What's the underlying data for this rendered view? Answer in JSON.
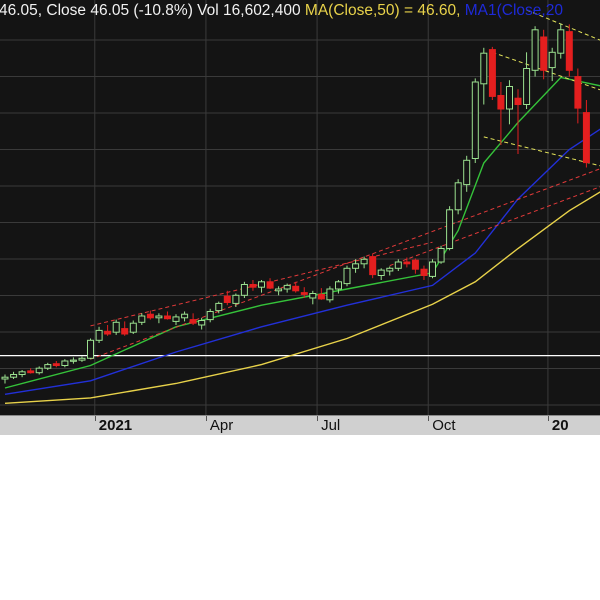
{
  "header": {
    "prefix_text": "46.05, Close 46.05 (-10.8%) Vol 16,602,400",
    "ma50_text": "MA(Close,50) = 46.60,",
    "ma20_text": "MA1(Close,20",
    "colors": {
      "base": "#f2f2f2",
      "ma50": "#e8d24a",
      "ma20": "#1e2ad8"
    }
  },
  "xaxis": {
    "labels": [
      {
        "text": "2021",
        "bold": true
      },
      {
        "text": "Apr",
        "bold": false
      },
      {
        "text": "Jul",
        "bold": false
      },
      {
        "text": "Oct",
        "bold": false
      },
      {
        "text": "20",
        "bold": true
      }
    ]
  },
  "chart_data": {
    "type": "candlestick",
    "title": "",
    "y_unit": "price",
    "week_index_domain": [
      0,
      68
    ],
    "price_range": [
      18,
      64
    ],
    "weeks": [
      {
        "o": 22.0,
        "h": 22.5,
        "l": 21.5,
        "c": 22.2
      },
      {
        "o": 22.2,
        "h": 22.8,
        "l": 22.0,
        "c": 22.5
      },
      {
        "o": 22.5,
        "h": 23.0,
        "l": 22.2,
        "c": 22.8
      },
      {
        "o": 22.9,
        "h": 23.2,
        "l": 22.6,
        "c": 22.7
      },
      {
        "o": 22.7,
        "h": 23.4,
        "l": 22.5,
        "c": 23.2
      },
      {
        "o": 23.2,
        "h": 23.8,
        "l": 23.0,
        "c": 23.6
      },
      {
        "o": 23.7,
        "h": 24.0,
        "l": 23.3,
        "c": 23.5
      },
      {
        "o": 23.5,
        "h": 24.2,
        "l": 23.3,
        "c": 24.0
      },
      {
        "o": 24.0,
        "h": 24.4,
        "l": 23.7,
        "c": 24.1
      },
      {
        "o": 24.1,
        "h": 24.5,
        "l": 23.9,
        "c": 24.3
      },
      {
        "o": 24.3,
        "h": 26.5,
        "l": 24.2,
        "c": 26.3
      },
      {
        "o": 26.3,
        "h": 27.8,
        "l": 26.0,
        "c": 27.4
      },
      {
        "o": 27.3,
        "h": 28.0,
        "l": 26.8,
        "c": 27.0
      },
      {
        "o": 27.2,
        "h": 28.6,
        "l": 26.9,
        "c": 28.3
      },
      {
        "o": 27.6,
        "h": 28.4,
        "l": 26.8,
        "c": 27.0
      },
      {
        "o": 27.2,
        "h": 28.5,
        "l": 27.0,
        "c": 28.2
      },
      {
        "o": 28.3,
        "h": 29.3,
        "l": 28.0,
        "c": 29.0
      },
      {
        "o": 29.2,
        "h": 29.6,
        "l": 28.6,
        "c": 28.8
      },
      {
        "o": 28.8,
        "h": 29.3,
        "l": 28.2,
        "c": 29.0
      },
      {
        "o": 29.0,
        "h": 29.5,
        "l": 28.6,
        "c": 28.7
      },
      {
        "o": 28.4,
        "h": 29.2,
        "l": 28.0,
        "c": 28.9
      },
      {
        "o": 28.8,
        "h": 29.5,
        "l": 28.4,
        "c": 29.2
      },
      {
        "o": 28.6,
        "h": 29.3,
        "l": 28.0,
        "c": 28.2
      },
      {
        "o": 28.0,
        "h": 28.8,
        "l": 27.5,
        "c": 28.5
      },
      {
        "o": 28.6,
        "h": 29.8,
        "l": 28.3,
        "c": 29.5
      },
      {
        "o": 29.6,
        "h": 30.6,
        "l": 29.3,
        "c": 30.4
      },
      {
        "o": 31.2,
        "h": 31.8,
        "l": 30.2,
        "c": 30.5
      },
      {
        "o": 30.4,
        "h": 31.5,
        "l": 30.0,
        "c": 31.3
      },
      {
        "o": 31.3,
        "h": 32.8,
        "l": 31.0,
        "c": 32.5
      },
      {
        "o": 32.5,
        "h": 33.0,
        "l": 31.8,
        "c": 32.2
      },
      {
        "o": 32.2,
        "h": 33.0,
        "l": 31.6,
        "c": 32.8
      },
      {
        "o": 32.8,
        "h": 33.2,
        "l": 32.0,
        "c": 32.1
      },
      {
        "o": 31.8,
        "h": 32.3,
        "l": 31.3,
        "c": 32.0
      },
      {
        "o": 32.0,
        "h": 32.6,
        "l": 31.6,
        "c": 32.4
      },
      {
        "o": 32.3,
        "h": 32.8,
        "l": 31.6,
        "c": 31.8
      },
      {
        "o": 31.6,
        "h": 32.2,
        "l": 31.0,
        "c": 31.4
      },
      {
        "o": 31.0,
        "h": 31.8,
        "l": 30.3,
        "c": 31.5
      },
      {
        "o": 31.4,
        "h": 32.1,
        "l": 30.8,
        "c": 30.9
      },
      {
        "o": 30.8,
        "h": 32.3,
        "l": 30.5,
        "c": 32.0
      },
      {
        "o": 32.0,
        "h": 33.0,
        "l": 31.5,
        "c": 32.8
      },
      {
        "o": 32.6,
        "h": 34.6,
        "l": 32.3,
        "c": 34.3
      },
      {
        "o": 34.3,
        "h": 35.3,
        "l": 33.8,
        "c": 34.8
      },
      {
        "o": 34.8,
        "h": 35.6,
        "l": 34.3,
        "c": 35.3
      },
      {
        "o": 35.6,
        "h": 35.9,
        "l": 33.2,
        "c": 33.6
      },
      {
        "o": 33.5,
        "h": 34.3,
        "l": 33.0,
        "c": 34.1
      },
      {
        "o": 34.0,
        "h": 34.5,
        "l": 33.5,
        "c": 34.3
      },
      {
        "o": 34.3,
        "h": 35.3,
        "l": 34.0,
        "c": 35.0
      },
      {
        "o": 35.0,
        "h": 35.5,
        "l": 34.4,
        "c": 34.8
      },
      {
        "o": 35.2,
        "h": 35.4,
        "l": 33.7,
        "c": 34.2
      },
      {
        "o": 34.2,
        "h": 34.6,
        "l": 33.0,
        "c": 33.5
      },
      {
        "o": 33.4,
        "h": 35.3,
        "l": 33.2,
        "c": 35.0
      },
      {
        "o": 35.0,
        "h": 36.8,
        "l": 34.8,
        "c": 36.5
      },
      {
        "o": 36.5,
        "h": 41.2,
        "l": 36.3,
        "c": 40.8
      },
      {
        "o": 40.8,
        "h": 44.2,
        "l": 40.3,
        "c": 43.8
      },
      {
        "o": 43.6,
        "h": 46.8,
        "l": 42.8,
        "c": 46.3
      },
      {
        "o": 46.5,
        "h": 55.4,
        "l": 46.0,
        "c": 55.0
      },
      {
        "o": 54.8,
        "h": 58.8,
        "l": 52.5,
        "c": 58.2
      },
      {
        "o": 58.6,
        "h": 58.9,
        "l": 53.0,
        "c": 53.4
      },
      {
        "o": 53.5,
        "h": 55.0,
        "l": 48.0,
        "c": 52.0
      },
      {
        "o": 52.0,
        "h": 55.2,
        "l": 50.3,
        "c": 54.5
      },
      {
        "o": 53.2,
        "h": 54.2,
        "l": 47.0,
        "c": 52.5
      },
      {
        "o": 52.5,
        "h": 58.3,
        "l": 52.0,
        "c": 56.5
      },
      {
        "o": 56.3,
        "h": 61.2,
        "l": 55.6,
        "c": 60.8
      },
      {
        "o": 60.0,
        "h": 60.8,
        "l": 55.3,
        "c": 56.3
      },
      {
        "o": 56.6,
        "h": 58.8,
        "l": 55.1,
        "c": 58.3
      },
      {
        "o": 58.2,
        "h": 61.5,
        "l": 57.6,
        "c": 60.8
      },
      {
        "o": 60.6,
        "h": 61.4,
        "l": 55.6,
        "c": 56.3
      },
      {
        "o": 55.6,
        "h": 56.5,
        "l": 50.4,
        "c": 52.1
      },
      {
        "o": 51.6,
        "h": 53.0,
        "l": 45.5,
        "c": 46.05
      }
    ],
    "ma20_close_blue": [
      {
        "i": 0,
        "v": 20.3
      },
      {
        "i": 10,
        "v": 21.8
      },
      {
        "i": 20,
        "v": 25.0
      },
      {
        "i": 30,
        "v": 27.8
      },
      {
        "i": 40,
        "v": 30.2
      },
      {
        "i": 50,
        "v": 32.4
      },
      {
        "i": 55,
        "v": 36.0
      },
      {
        "i": 60,
        "v": 42.0
      },
      {
        "i": 66,
        "v": 47.5
      },
      {
        "i": 70,
        "v": 50.0
      }
    ],
    "ma50_close_yellow": [
      {
        "i": 0,
        "v": 19.3
      },
      {
        "i": 10,
        "v": 19.9
      },
      {
        "i": 20,
        "v": 21.5
      },
      {
        "i": 30,
        "v": 23.6
      },
      {
        "i": 40,
        "v": 26.5
      },
      {
        "i": 50,
        "v": 30.3
      },
      {
        "i": 55,
        "v": 32.8
      },
      {
        "i": 60,
        "v": 36.5
      },
      {
        "i": 66,
        "v": 40.7
      },
      {
        "i": 70,
        "v": 43.0
      }
    ],
    "ma10_close_green": [
      {
        "i": 0,
        "v": 21.0
      },
      {
        "i": 10,
        "v": 23.5
      },
      {
        "i": 20,
        "v": 27.8
      },
      {
        "i": 30,
        "v": 30.2
      },
      {
        "i": 40,
        "v": 32.0
      },
      {
        "i": 50,
        "v": 33.8
      },
      {
        "i": 53,
        "v": 38.5
      },
      {
        "i": 56,
        "v": 46.0
      },
      {
        "i": 60,
        "v": 50.5
      },
      {
        "i": 65,
        "v": 55.5
      },
      {
        "i": 70,
        "v": 54.5
      }
    ],
    "trend_lines": [
      {
        "color": "#e23a3a",
        "dash": true,
        "from": {
          "i": 10,
          "v": 27.9
        },
        "to": {
          "i": 50,
          "v": 37.2
        }
      },
      {
        "color": "#e23a3a",
        "dash": true,
        "from": {
          "i": 10,
          "v": 24.2
        },
        "to": {
          "i": 70,
          "v": 45.5
        }
      },
      {
        "color": "#e23a3a",
        "dash": true,
        "from": {
          "i": 45,
          "v": 34.6
        },
        "to": {
          "i": 70,
          "v": 43.5
        }
      },
      {
        "color": "#e3e35a",
        "dash": true,
        "from": {
          "i": 61,
          "v": 63.0
        },
        "to": {
          "i": 70,
          "v": 59.5
        }
      },
      {
        "color": "#e3e35a",
        "dash": true,
        "from": {
          "i": 57,
          "v": 58.3
        },
        "to": {
          "i": 70,
          "v": 54.0
        }
      },
      {
        "color": "#e3e35a",
        "dash": true,
        "from": {
          "i": 56,
          "v": 48.9
        },
        "to": {
          "i": 70,
          "v": 45.6
        }
      }
    ],
    "horizontal_line": {
      "v": 24.6,
      "color": "#ffffff"
    },
    "x_ticks": [
      {
        "label_index": 0,
        "i": 10.5
      },
      {
        "label_index": 1,
        "i": 23.5
      },
      {
        "label_index": 2,
        "i": 36.5
      },
      {
        "label_index": 3,
        "i": 49.5
      },
      {
        "label_index": 4,
        "i": 63.5
      }
    ],
    "grid": true
  }
}
